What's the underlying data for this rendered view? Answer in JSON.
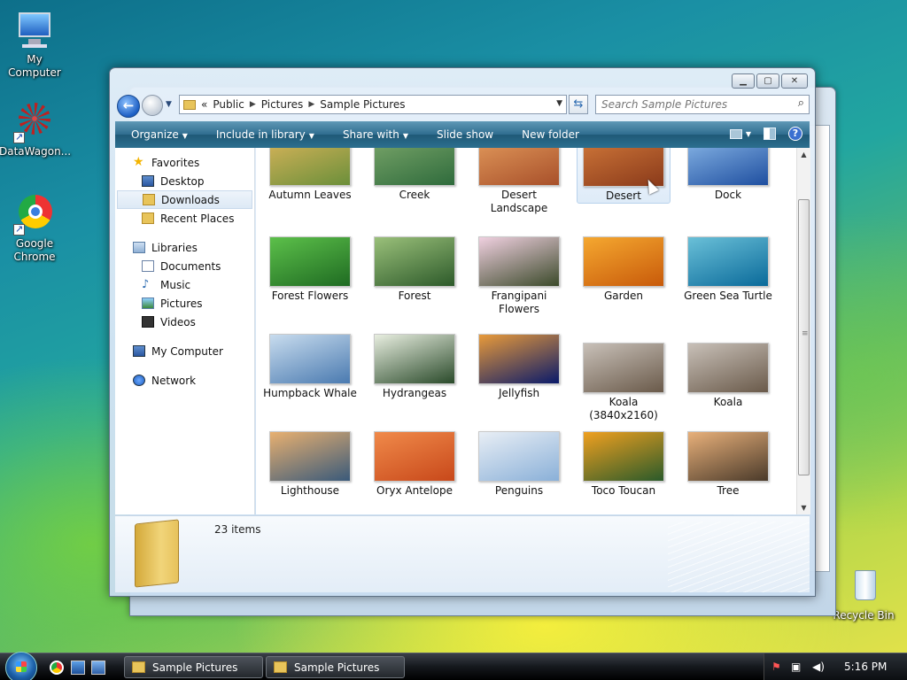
{
  "desktop": {
    "icons": [
      {
        "label": "My Computer"
      },
      {
        "label": "DataWagon..."
      },
      {
        "label": "Google Chrome"
      },
      {
        "label": "Recycle Bin"
      }
    ]
  },
  "window": {
    "breadcrumb_prefix": "«",
    "breadcrumb": [
      "Public",
      "Pictures",
      "Sample Pictures"
    ],
    "search_placeholder": "Search Sample Pictures",
    "toolbar": {
      "organize": "Organize",
      "include_in_library": "Include in library",
      "share_with": "Share with",
      "slide_show": "Slide show",
      "new_folder": "New folder"
    },
    "nav": {
      "favorites": "Favorites",
      "desktop": "Desktop",
      "downloads": "Downloads",
      "recent_places": "Recent Places",
      "libraries": "Libraries",
      "documents": "Documents",
      "music": "Music",
      "pictures": "Pictures",
      "videos": "Videos",
      "my_computer": "My Computer",
      "network": "Network"
    },
    "files": [
      {
        "name": "Autumn Leaves",
        "colors": [
          "#6b8f3a",
          "#d9b45a"
        ]
      },
      {
        "name": "Creek",
        "colors": [
          "#2f6b3c",
          "#7aa66a"
        ]
      },
      {
        "name": "Desert Landscape",
        "colors": [
          "#a8502a",
          "#e29a5c"
        ]
      },
      {
        "name": "Desert",
        "colors": [
          "#8a3a1a",
          "#d0783a"
        ]
      },
      {
        "name": "Dock",
        "colors": [
          "#1f4fa0",
          "#8ab8e8"
        ]
      },
      {
        "name": "Forest Flowers",
        "colors": [
          "#1f6b22",
          "#5cc04a"
        ]
      },
      {
        "name": "Forest",
        "colors": [
          "#2d5a2a",
          "#9ac07a"
        ]
      },
      {
        "name": "Frangipani Flowers",
        "colors": [
          "#3b4a2a",
          "#f0d0e0"
        ]
      },
      {
        "name": "Garden",
        "colors": [
          "#c85a0a",
          "#f5a830"
        ]
      },
      {
        "name": "Green Sea Turtle",
        "colors": [
          "#0a6a9a",
          "#6ac0d8"
        ]
      },
      {
        "name": "Humpback Whale",
        "colors": [
          "#4a7ab0",
          "#c8dcee"
        ]
      },
      {
        "name": "Hydrangeas",
        "colors": [
          "#2a4a2a",
          "#e8eee0"
        ]
      },
      {
        "name": "Jellyfish",
        "colors": [
          "#0a1a6a",
          "#e89a3a"
        ]
      },
      {
        "name": "Koala (3840x2160)",
        "colors": [
          "#6a5a4a",
          "#c8c0b8"
        ]
      },
      {
        "name": "Koala",
        "colors": [
          "#6a5a4a",
          "#c8c0b8"
        ]
      },
      {
        "name": "Lighthouse",
        "colors": [
          "#3a5a7a",
          "#e8b070"
        ]
      },
      {
        "name": "Oryx Antelope",
        "colors": [
          "#c8481a",
          "#f08a4a"
        ]
      },
      {
        "name": "Penguins",
        "colors": [
          "#8ab0d8",
          "#e8eef5"
        ]
      },
      {
        "name": "Toco Toucan",
        "colors": [
          "#2a5a2a",
          "#f0a020"
        ]
      },
      {
        "name": "Tree",
        "colors": [
          "#4a3a2a",
          "#e8b07a"
        ]
      },
      {
        "name": "",
        "colors": [
          "#e8a80a",
          "#f8e060"
        ]
      },
      {
        "name": "",
        "colors": [
          "#3a6a3a",
          "#c0c8c0"
        ]
      },
      {
        "name": "",
        "colors": [
          "#a82a3a",
          "#e87a80"
        ]
      }
    ],
    "item_count": "23 items"
  },
  "taskbar": {
    "buttons": [
      "Sample Pictures",
      "Sample Pictures"
    ],
    "clock": "5:16 PM"
  }
}
